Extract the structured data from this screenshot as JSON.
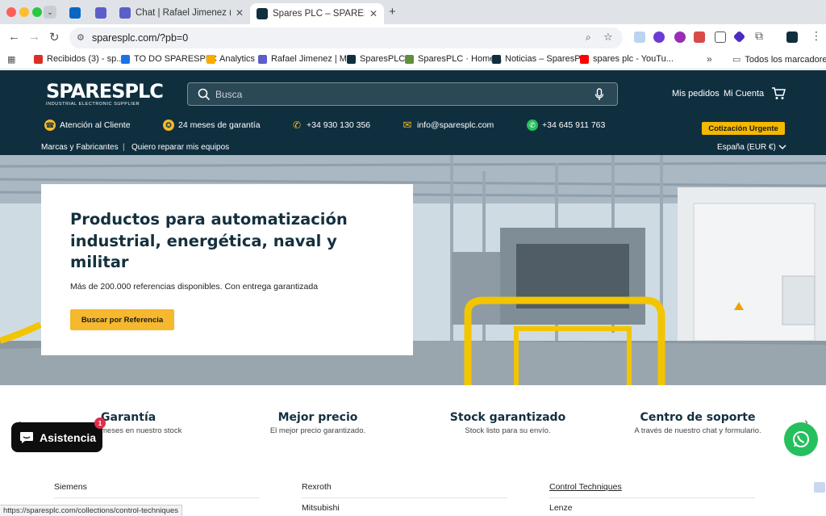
{
  "browser": {
    "tabs": [
      {
        "label": ""
      },
      {
        "label": ""
      },
      {
        "label": ""
      },
      {
        "label": "Chat | Rafael Jimenez (Usted)"
      },
      {
        "label": "Spares PLC – SPARES PLC"
      }
    ],
    "new_tab": "+",
    "url": "sparesplc.com/?pb=0",
    "bookmarks": [
      {
        "label": "Recibidos (3) - sp...",
        "color": "#d93025"
      },
      {
        "label": "TO DO SPARESPLC",
        "color": "#1a73e8"
      },
      {
        "label": "Analytics",
        "color": "#f9ab00"
      },
      {
        "label": "Rafael Jimenez | M...",
        "color": "#5b5fc7"
      },
      {
        "label": "SparesPLC",
        "color": "#0f2f3f"
      },
      {
        "label": "SparesPLC · Home...",
        "color": "#5e8e3e"
      },
      {
        "label": "Noticias – SparesP...",
        "color": "#0f2f3f"
      },
      {
        "label": "spares plc - YouTu...",
        "color": "#ff0000"
      }
    ],
    "bookmarks_more": "»",
    "all_bookmarks": "Todos los marcadores",
    "status_url": "https://sparesplc.com/collections/control-techniques"
  },
  "header": {
    "logo_main": "SPARESPLC",
    "logo_sub": "INDUSTRIAL ELECTRONIC SUPPLIER",
    "search_placeholder": "Busca",
    "orders": "Mis pedidos",
    "account": "Mi Cuenta",
    "info": [
      {
        "label": "Atención al Cliente",
        "icon": "headset-icon"
      },
      {
        "label": "24 meses de garantía",
        "icon": "warranty-badge-icon"
      },
      {
        "label": "+34 930 130 356",
        "icon": "phone-icon"
      },
      {
        "label": "info@sparesplc.com",
        "icon": "mail-icon"
      },
      {
        "label": "+34 645 911 763",
        "icon": "whatsapp-icon"
      }
    ],
    "urgent": "Cotización Urgente",
    "nav": [
      {
        "label": "Marcas y Fabricantes"
      },
      {
        "label": "Quiero reparar mis equipos"
      }
    ],
    "nav_separator": "|",
    "region": "España (EUR €)",
    "colors": {
      "header_bg": "#0f2f3f",
      "accent": "#f5b82e"
    }
  },
  "hero": {
    "title": "Productos para automatización industrial, energética, naval y militar",
    "subtitle": "Más de 200.000 referencias disponibles. Con entrega garantizada",
    "button": "Buscar por Referencia"
  },
  "features": [
    {
      "title": "Garantía",
      "subtitle": "meses en nuestro stock"
    },
    {
      "title": "Mejor precio",
      "subtitle": "El mejor precio garantizado."
    },
    {
      "title": "Stock garantizado",
      "subtitle": "Stock listo para su envío."
    },
    {
      "title": "Centro de soporte",
      "subtitle": "A través de nuestro chat y formulario."
    }
  ],
  "chat": {
    "label": "Asistencia",
    "badge": "1"
  },
  "brands": [
    "Siemens",
    "Rexroth",
    "Control Techniques",
    "Mitsubishi",
    "Lenze"
  ]
}
